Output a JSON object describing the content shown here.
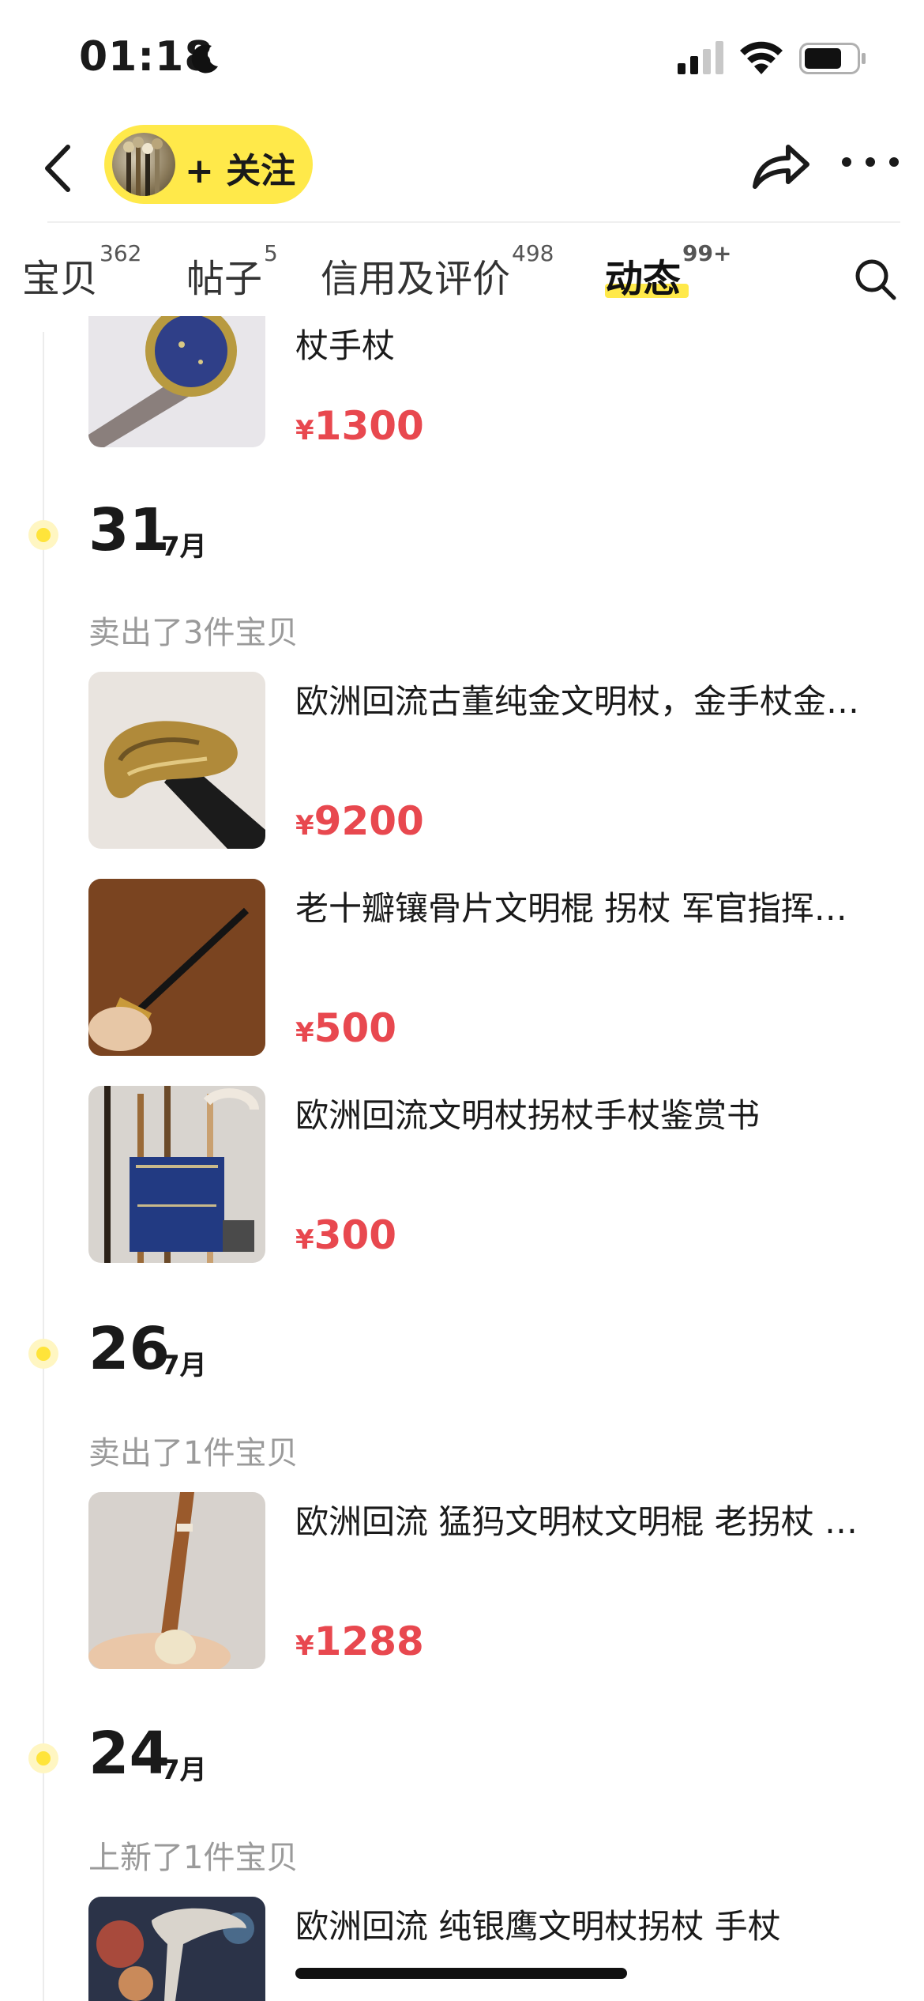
{
  "status": {
    "time": "01:18"
  },
  "header": {
    "follow_label": "+ 关注"
  },
  "tabs": [
    {
      "label": "宝贝",
      "count": "362"
    },
    {
      "label": "帖子",
      "count": "5"
    },
    {
      "label": "信用及评价",
      "count": "498"
    },
    {
      "label": "动态",
      "count": "99+"
    }
  ],
  "feed": {
    "top_item": {
      "title": "杖手杖",
      "currency": "¥",
      "price": "1300"
    },
    "groups": [
      {
        "day": "31",
        "month": "7月",
        "action": "卖出了3件宝贝",
        "items": [
          {
            "title": "欧洲回流古董纯金文明杖，金手杖金…",
            "currency": "¥",
            "price": "9200"
          },
          {
            "title": "老十瓣镶骨片文明棍 拐杖 军官指挥…",
            "currency": "¥",
            "price": "500"
          },
          {
            "title": "欧洲回流文明杖拐杖手杖鉴赏书",
            "currency": "¥",
            "price": "300"
          }
        ]
      },
      {
        "day": "26",
        "month": "7月",
        "action": "卖出了1件宝贝",
        "items": [
          {
            "title": "欧洲回流 猛犸文明杖文明棍 老拐杖 …",
            "currency": "¥",
            "price": "1288"
          }
        ]
      },
      {
        "day": "24",
        "month": "7月",
        "action": "上新了1件宝贝",
        "items": [
          {
            "title": "欧洲回流 纯银鹰文明杖拐杖 手杖"
          }
        ]
      }
    ]
  },
  "colors": {
    "accent": "#ffe94a",
    "price": "#e8484f",
    "muted": "#9a9a9a"
  },
  "icons": [
    "moon-icon",
    "signal-icon",
    "wifi-icon",
    "battery-icon",
    "back-arrow-icon",
    "share-icon",
    "more-icon",
    "search-icon"
  ]
}
